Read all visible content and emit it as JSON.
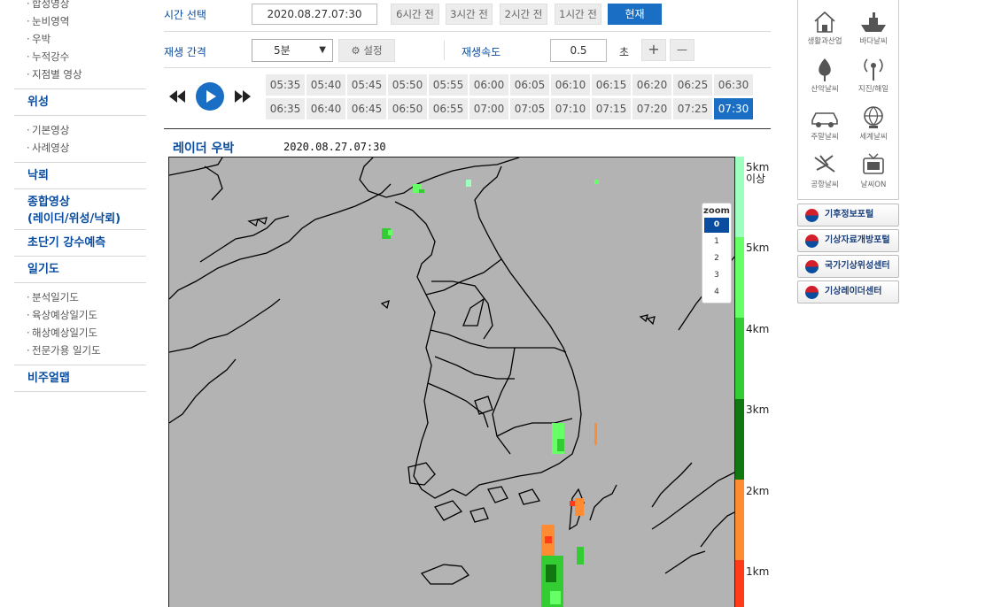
{
  "leftnav": {
    "top_items": [
      "합성영상",
      "눈비영역",
      "우박",
      "누적강수",
      "지점별 영상"
    ],
    "satellite": {
      "label": "위성",
      "items": [
        "기본영상",
        "사례영상"
      ]
    },
    "lightning": "낙뢰",
    "combined": {
      "line1": "종합영상",
      "line2": "(레이더/위성/낙뢰)"
    },
    "nowcast": "초단기 강수예측",
    "weather_chart": {
      "label": "일기도",
      "items": [
        "분석일기도",
        "육상예상일기도",
        "해상예상일기도",
        "전문가용 일기도"
      ]
    },
    "visual_map": "비주얼맵"
  },
  "controls": {
    "time_label": "시간 선택",
    "time_value": "2020.08.27.07:30",
    "quick_times": [
      "6시간 전",
      "3시간 전",
      "2시간 전",
      "1시간 전"
    ],
    "now_button": "현재",
    "interval_label": "재생 간격",
    "interval_value": "5분",
    "settings_label": "설정",
    "speed_label": "재생속도",
    "speed_value": "0.5",
    "speed_unit": "초",
    "plus": "+",
    "minus": "—"
  },
  "frames": [
    "05:35",
    "05:40",
    "05:45",
    "05:50",
    "05:55",
    "06:00",
    "06:05",
    "06:10",
    "06:15",
    "06:20",
    "06:25",
    "06:30",
    "06:35",
    "06:40",
    "06:45",
    "06:50",
    "06:55",
    "07:00",
    "07:05",
    "07:10",
    "07:15",
    "07:20",
    "07:25",
    "07:30"
  ],
  "active_frame": "07:30",
  "map": {
    "title": "레이더 우박",
    "timestamp": "2020.08.27.07:30",
    "zoom_label": "zoom",
    "zoom_levels": [
      "0",
      "1",
      "2",
      "3",
      "4"
    ],
    "active_zoom": "0"
  },
  "legend": {
    "labels": [
      "5km\n이상",
      "5km",
      "4km",
      "3km",
      "2km",
      "1km"
    ],
    "colors": [
      "#9dffc0",
      "#66ff66",
      "#33cc33",
      "#117711",
      "#ff8c33",
      "#ff3b1a"
    ]
  },
  "quick_links": [
    {
      "label": "생활과산업",
      "icon": "house-icon"
    },
    {
      "label": "바다날씨",
      "icon": "ship-icon"
    },
    {
      "label": "산악날씨",
      "icon": "tree-icon"
    },
    {
      "label": "지진/해일",
      "icon": "antenna-icon"
    },
    {
      "label": "주말날씨",
      "icon": "car-icon"
    },
    {
      "label": "세계날씨",
      "icon": "globe-icon"
    },
    {
      "label": "공항날씨",
      "icon": "airplane-icon"
    },
    {
      "label": "날씨ON",
      "icon": "tv-icon"
    }
  ],
  "portals": [
    "기후정보포털",
    "기상자료개방포털",
    "국가기상위성센터",
    "기상레이더센터"
  ]
}
